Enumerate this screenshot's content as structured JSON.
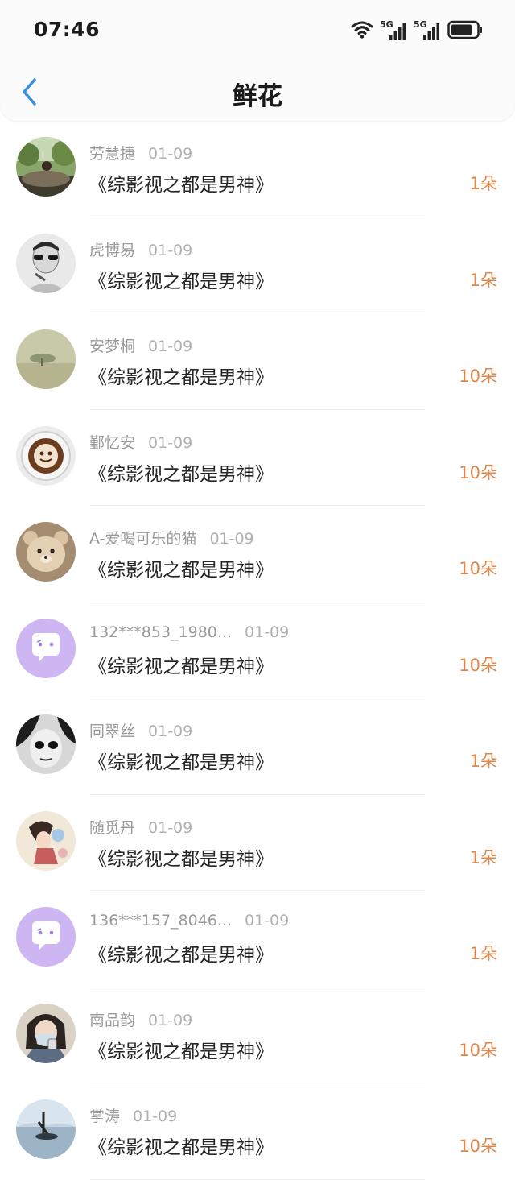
{
  "status_bar": {
    "time": "07:46",
    "wifi_icon": "wifi-icon",
    "signal_1_label": "5G",
    "signal_2_label": "5G",
    "battery_icon": "battery-icon"
  },
  "header": {
    "title": "鲜花",
    "back_icon": "chevron-left-icon",
    "accent": "#3a8ee6"
  },
  "colors": {
    "amount": "#e0874a",
    "meta": "#9a9a9a",
    "avatar_default": "#cdb6f2"
  },
  "items": [
    {
      "name": "劳慧捷",
      "date": "01-09",
      "book": "《综影视之都是男神》",
      "amount": "1朵",
      "avatar": "photo-nature"
    },
    {
      "name": "虎博易",
      "date": "01-09",
      "book": "《综影视之都是男神》",
      "amount": "1朵",
      "avatar": "photo-man-sunglasses"
    },
    {
      "name": "安梦桐",
      "date": "01-09",
      "book": "《综影视之都是男神》",
      "amount": "10朵",
      "avatar": "photo-tree-field"
    },
    {
      "name": "鄞忆安",
      "date": "01-09",
      "book": "《综影视之都是男神》",
      "amount": "10朵",
      "avatar": "photo-latte-art"
    },
    {
      "name": "A-爱喝可乐的猫",
      "date": "01-09",
      "book": "《综影视之都是男神》",
      "amount": "10朵",
      "avatar": "photo-bear-costume"
    },
    {
      "name": "132***853_1980...",
      "date": "01-09",
      "book": "《综影视之都是男神》",
      "amount": "10朵",
      "avatar": "default-chat-avatar"
    },
    {
      "name": "同翠丝",
      "date": "01-09",
      "book": "《综影视之都是男神》",
      "amount": "1朵",
      "avatar": "photo-dark-face"
    },
    {
      "name": "随觅丹",
      "date": "01-09",
      "book": "《综影视之都是男神》",
      "amount": "1朵",
      "avatar": "photo-anime"
    },
    {
      "name": "136***157_8046...",
      "date": "01-09",
      "book": "《综影视之都是男神》",
      "amount": "1朵",
      "avatar": "default-chat-avatar"
    },
    {
      "name": "南品韵",
      "date": "01-09",
      "book": "《综影视之都是男神》",
      "amount": "10朵",
      "avatar": "photo-masked-selfie"
    },
    {
      "name": "掌涛",
      "date": "01-09",
      "book": "《综影视之都是男神》",
      "amount": "10朵",
      "avatar": "photo-harbor"
    }
  ]
}
